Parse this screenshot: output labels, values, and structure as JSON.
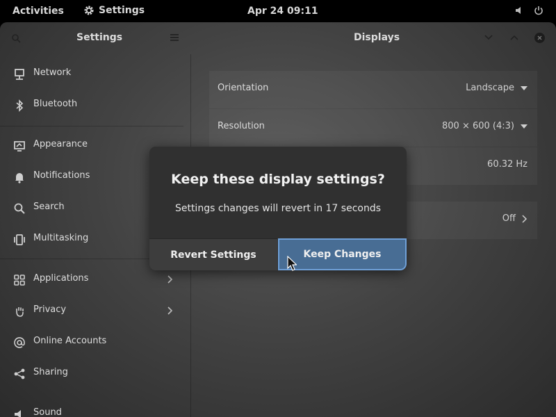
{
  "topbar": {
    "activities": "Activities",
    "app_name": "Settings",
    "clock": "Apr 24  09:11"
  },
  "headerbar": {
    "left_title": "Settings",
    "right_title": "Displays"
  },
  "sidebar": {
    "items": [
      {
        "label": "Network",
        "icon": "network-icon"
      },
      {
        "label": "Bluetooth",
        "icon": "bluetooth-icon"
      },
      {
        "label": "Appearance",
        "icon": "appearance-icon"
      },
      {
        "label": "Notifications",
        "icon": "bell-icon"
      },
      {
        "label": "Search",
        "icon": "search-icon"
      },
      {
        "label": "Multitasking",
        "icon": "multitasking-icon"
      },
      {
        "label": "Applications",
        "icon": "grid-icon"
      },
      {
        "label": "Privacy",
        "icon": "hand-icon"
      },
      {
        "label": "Online Accounts",
        "icon": "at-icon"
      },
      {
        "label": "Sharing",
        "icon": "share-icon"
      },
      {
        "label": "Sound",
        "icon": "speaker-icon"
      }
    ]
  },
  "displays": {
    "orientation_label": "Orientation",
    "orientation_value": "Landscape",
    "resolution_label": "Resolution",
    "resolution_value": "800 × 600 (4:3)",
    "refresh_value": "60.32 Hz",
    "night_light_value": "Off"
  },
  "dialog": {
    "title": "Keep these display settings?",
    "body": "Settings changes will revert in 17 seconds",
    "revert_label": "Revert Settings",
    "keep_label": "Keep Changes"
  }
}
